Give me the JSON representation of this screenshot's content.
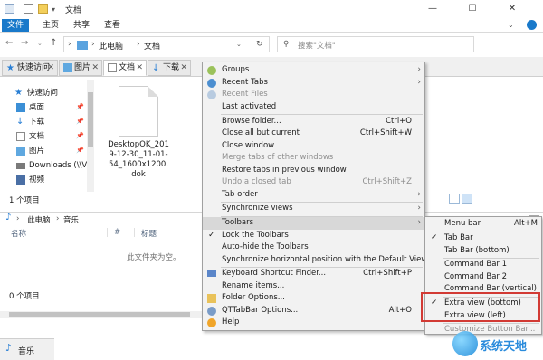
{
  "window": {
    "title": "文档",
    "controls": [
      "—",
      "☐",
      "✕"
    ]
  },
  "ribbon_tabs": [
    "文件",
    "主页",
    "共享",
    "查看"
  ],
  "address": {
    "path": [
      "此电脑",
      "文档"
    ],
    "search_placeholder": "搜索\"文档\""
  },
  "qt_tabs": [
    "快速访问",
    "图片",
    "文档",
    "下载"
  ],
  "nav_pane": {
    "header": "快速访问",
    "items": [
      "桌面",
      "下载",
      "文档",
      "图片",
      "Downloads (\\\\V",
      "视频"
    ]
  },
  "file": {
    "name": "DesktopOK_2019-12-30_11-01-54_1600x1200.dok"
  },
  "status": {
    "items": "1 个项目"
  },
  "pane2": {
    "path": [
      "此电脑",
      "音乐"
    ],
    "columns": [
      "名称",
      "#",
      "标题"
    ],
    "empty_message": "此文件夹为空。",
    "status": "0 个项目",
    "tab": "音乐"
  },
  "menu": {
    "items": [
      {
        "label": "Groups",
        "submenu": true
      },
      {
        "label": "Recent Tabs",
        "submenu": true
      },
      {
        "label": "Recent Files",
        "disabled": true
      },
      {
        "label": "Last activated"
      },
      {
        "label": "Browse folder...",
        "shortcut": "Ctrl+O"
      },
      {
        "label": "Close all but current",
        "shortcut": "Ctrl+Shift+W"
      },
      {
        "label": "Close window"
      },
      {
        "label": "Merge tabs of other windows",
        "disabled": true
      },
      {
        "label": "Restore tabs in previous window"
      },
      {
        "label": "Undo a closed tab",
        "shortcut": "Ctrl+Shift+Z",
        "disabled": true
      },
      {
        "label": "Tab order",
        "submenu": true
      },
      {
        "label": "Synchronize views",
        "submenu": true
      },
      {
        "label": "Toolbars",
        "submenu": true
      },
      {
        "label": "Lock the Toolbars"
      },
      {
        "label": "Auto-hide the Toolbars"
      },
      {
        "label": "Synchronize horizontal position with the Default View"
      },
      {
        "label": "Keyboard Shortcut Finder...",
        "shortcut": "Ctrl+Shift+P"
      },
      {
        "label": "Rename items..."
      },
      {
        "label": "Folder Options..."
      },
      {
        "label": "QTTabBar Options...",
        "shortcut": "Alt+O"
      },
      {
        "label": "Help"
      }
    ]
  },
  "submenu": {
    "items": [
      {
        "label": "Menu bar",
        "shortcut": "Alt+M"
      },
      {
        "label": "Tab Bar",
        "checked": true
      },
      {
        "label": "Tab Bar (bottom)"
      },
      {
        "label": "Command Bar 1"
      },
      {
        "label": "Command Bar 2"
      },
      {
        "label": "Command Bar (vertical)"
      },
      {
        "label": "Extra view (bottom)",
        "checked": true
      },
      {
        "label": "Extra view (left)"
      },
      {
        "label": "Customize Button Bar...",
        "disabled": true
      }
    ]
  },
  "watermark": "系统天地",
  "colors": {
    "accent": "#1979ca",
    "highlight_box": "#d23a34"
  }
}
